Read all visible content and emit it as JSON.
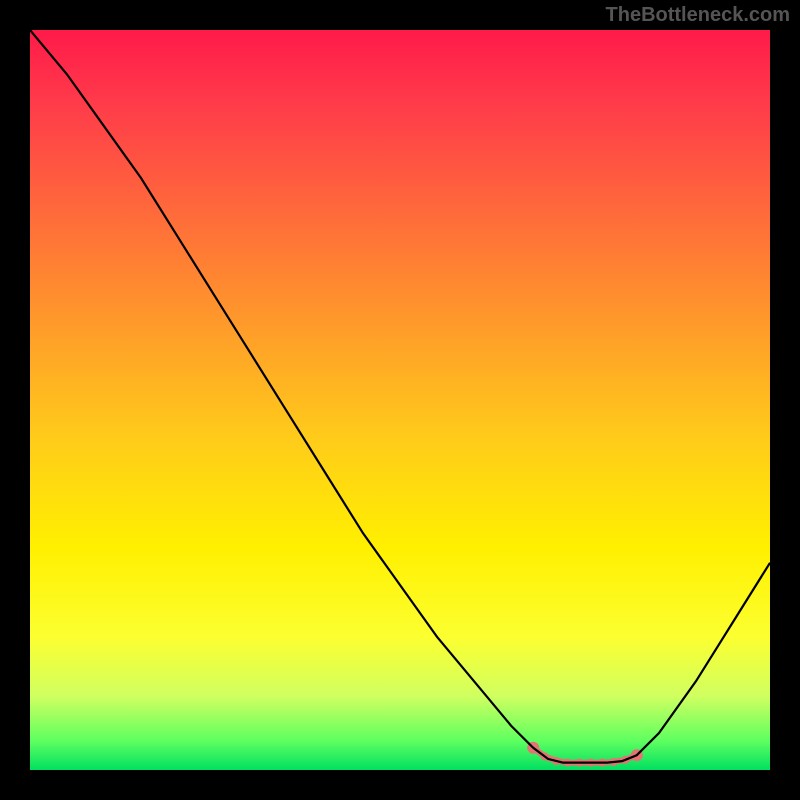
{
  "watermark": "TheBottleneck.com",
  "chart_data": {
    "type": "line",
    "title": "",
    "xlabel": "",
    "ylabel": "",
    "xlim": [
      0,
      100
    ],
    "ylim": [
      0,
      100
    ],
    "x": [
      0,
      5,
      10,
      15,
      20,
      25,
      30,
      35,
      40,
      45,
      50,
      55,
      60,
      65,
      68,
      70,
      72,
      74,
      76,
      78,
      80,
      82,
      85,
      90,
      95,
      100
    ],
    "values": [
      100,
      94,
      87,
      80,
      72,
      64,
      56,
      48,
      40,
      32,
      25,
      18,
      12,
      6,
      3,
      1.5,
      1,
      1,
      1,
      1,
      1.2,
      2,
      5,
      12,
      20,
      28
    ],
    "marker_region": {
      "x_start": 68,
      "x_end": 82,
      "color": "#e57373",
      "description": "highlighted optimal range near minimum"
    },
    "background": "vertical gradient red-orange-yellow-green",
    "annotations": []
  }
}
